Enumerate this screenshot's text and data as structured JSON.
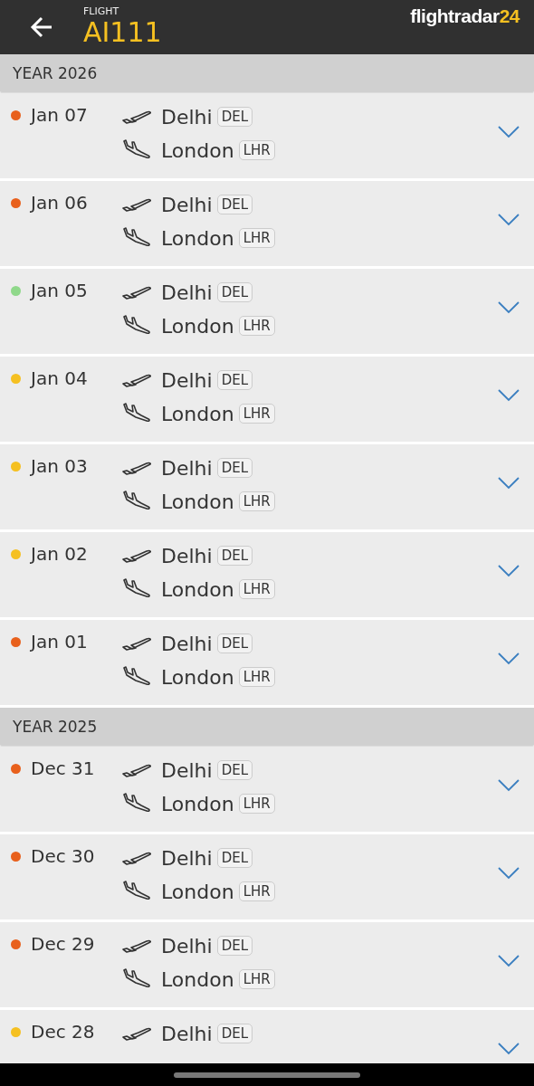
{
  "header": {
    "label": "FLIGHT",
    "flight": "AI111",
    "logo_text": "flightradar",
    "logo_number": "24"
  },
  "sections": [
    {
      "year": "YEAR 2026",
      "flights": [
        {
          "date": "Jan 07",
          "color": "#e8601c",
          "departure": {
            "city": "Delhi",
            "code": "DEL"
          },
          "arrival": {
            "city": "London",
            "code": "LHR"
          }
        },
        {
          "date": "Jan 06",
          "color": "#e8601c",
          "departure": {
            "city": "Delhi",
            "code": "DEL"
          },
          "arrival": {
            "city": "London",
            "code": "LHR"
          }
        },
        {
          "date": "Jan 05",
          "color": "#8fd88a",
          "departure": {
            "city": "Delhi",
            "code": "DEL"
          },
          "arrival": {
            "city": "London",
            "code": "LHR"
          }
        },
        {
          "date": "Jan 04",
          "color": "#f5c021",
          "departure": {
            "city": "Delhi",
            "code": "DEL"
          },
          "arrival": {
            "city": "London",
            "code": "LHR"
          }
        },
        {
          "date": "Jan 03",
          "color": "#f5c021",
          "departure": {
            "city": "Delhi",
            "code": "DEL"
          },
          "arrival": {
            "city": "London",
            "code": "LHR"
          }
        },
        {
          "date": "Jan 02",
          "color": "#f5c021",
          "departure": {
            "city": "Delhi",
            "code": "DEL"
          },
          "arrival": {
            "city": "London",
            "code": "LHR"
          }
        },
        {
          "date": "Jan 01",
          "color": "#e8601c",
          "departure": {
            "city": "Delhi",
            "code": "DEL"
          },
          "arrival": {
            "city": "London",
            "code": "LHR"
          }
        }
      ]
    },
    {
      "year": "YEAR 2025",
      "flights": [
        {
          "date": "Dec 31",
          "color": "#e8601c",
          "departure": {
            "city": "Delhi",
            "code": "DEL"
          },
          "arrival": {
            "city": "London",
            "code": "LHR"
          }
        },
        {
          "date": "Dec 30",
          "color": "#e8601c",
          "departure": {
            "city": "Delhi",
            "code": "DEL"
          },
          "arrival": {
            "city": "London",
            "code": "LHR"
          }
        },
        {
          "date": "Dec 29",
          "color": "#e8601c",
          "departure": {
            "city": "Delhi",
            "code": "DEL"
          },
          "arrival": {
            "city": "London",
            "code": "LHR"
          }
        },
        {
          "date": "Dec 28",
          "color": "#f5c021",
          "departure": {
            "city": "Delhi",
            "code": "DEL"
          }
        }
      ]
    }
  ]
}
